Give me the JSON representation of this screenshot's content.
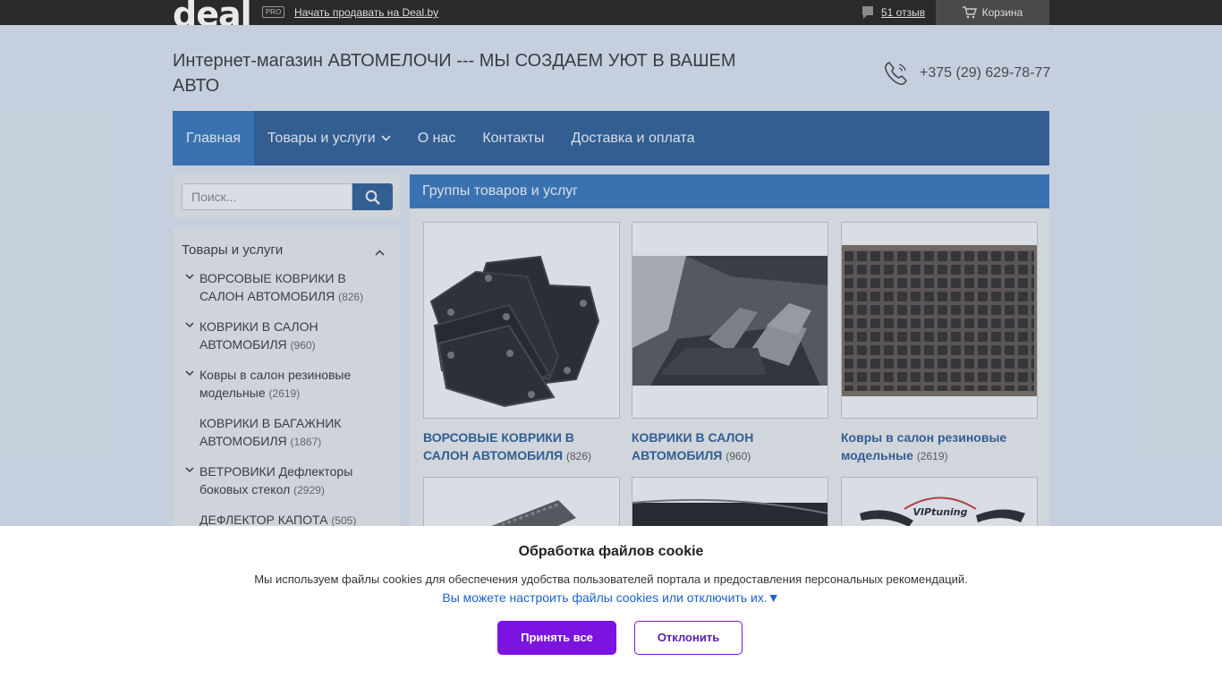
{
  "topbar": {
    "logo": "deal",
    "pro_badge": "PRO",
    "sell_link": "Начать продавать на Deal.by",
    "reviews_link": "51 отзыв",
    "cart_label": "Корзина"
  },
  "header": {
    "shop_title": "Интернет-магазин АВТОМЕЛОЧИ --- МЫ СОЗДАЕМ УЮТ В ВАШЕМ АВТО",
    "phone": "+375 (29) 629-78-77"
  },
  "nav": {
    "items": [
      {
        "label": "Главная",
        "active": true
      },
      {
        "label": "Товары и услуги",
        "dropdown": true
      },
      {
        "label": "О нас"
      },
      {
        "label": "Контакты"
      },
      {
        "label": "Доставка и оплата"
      }
    ]
  },
  "search": {
    "placeholder": "Поиск..."
  },
  "sidebar": {
    "heading": "Товары и услуги",
    "items": [
      {
        "label": "ВОРСОВЫЕ КОВРИКИ В САЛОН АВТОМОБИЛЯ",
        "count": "(826)",
        "expandable": true
      },
      {
        "label": "КОВРИКИ В САЛОН АВТОМОБИЛЯ",
        "count": "(960)",
        "expandable": true
      },
      {
        "label": "Ковры в салон резиновые модельные",
        "count": "(2619)",
        "expandable": true
      },
      {
        "label": "КОВРИКИ В БАГАЖНИК АВТОМОБИЛЯ",
        "count": "(1867)",
        "expandable": false
      },
      {
        "label": "ВЕТРОВИКИ Дефлекторы боковых стекол",
        "count": "(2929)",
        "expandable": true
      },
      {
        "label": "ДЕФЛЕКТОР КАПОТА",
        "count": "(505)",
        "expandable": false
      }
    ]
  },
  "groups": {
    "heading": "Группы товаров и услуг",
    "cards": [
      {
        "name": "ВОРСОВЫЕ КОВРИКИ В САЛОН АВТОМОБИЛЯ",
        "count": "(826)",
        "image": "textile-car-mats"
      },
      {
        "name": "КОВРИКИ В САЛОН АВТОМОБИЛЯ",
        "count": "(960)",
        "image": "car-interior-floor-mat"
      },
      {
        "name": "Ковры в салон резиновые модельные",
        "count": "(2619)",
        "image": "rubber-grid-mat"
      },
      {
        "name": "",
        "count": "",
        "image": "rubber-mat-edge"
      },
      {
        "name": "",
        "count": "",
        "image": "dashboard-cover"
      },
      {
        "name": "",
        "count": "",
        "image": "vip-tuning-deflectors",
        "logo_text": "VIPtuning"
      }
    ]
  },
  "cookie": {
    "title": "Обработка файлов cookie",
    "text": "Мы используем файлы cookies для обеспечения удобства пользователей портала и предоставления персональных рекомендаций.",
    "settings_link": "Вы можете настроить файлы cookies или отключить их.▼",
    "accept": "Принять все",
    "decline": "Отклонить"
  },
  "colors": {
    "nav_bg": "#2a5d97",
    "nav_active": "#3476be",
    "accent_purple": "#7b14e0",
    "link_blue": "#1a63c9"
  }
}
